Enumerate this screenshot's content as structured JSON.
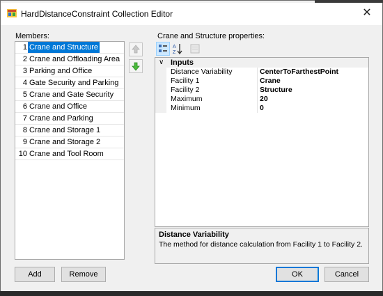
{
  "window": {
    "title": "HardDistanceConstraint Collection Editor",
    "close_glyph": "✕"
  },
  "members": {
    "label": "Members:",
    "selected_index": 0,
    "items": [
      {
        "num": "1",
        "label": "Crane and Structure"
      },
      {
        "num": "2",
        "label": "Crane and Offloading Area"
      },
      {
        "num": "3",
        "label": "Parking and Office"
      },
      {
        "num": "4",
        "label": "Gate Security and Parking"
      },
      {
        "num": "5",
        "label": "Crane and Gate Security"
      },
      {
        "num": "6",
        "label": "Crane and Office"
      },
      {
        "num": "7",
        "label": "Crane and Parking"
      },
      {
        "num": "8",
        "label": "Crane and Storage 1"
      },
      {
        "num": "9",
        "label": "Crane and Storage 2"
      },
      {
        "num": "10",
        "label": "Crane and Tool Room"
      }
    ]
  },
  "properties": {
    "label": "Crane and Structure properties:",
    "toolbar": {
      "categorized_icon": "categorized-icon",
      "alphabetical_icon": "alphabetical-icon",
      "pages_icon": "property-pages-icon"
    },
    "category": {
      "chevron": "∨",
      "name": "Inputs"
    },
    "rows": [
      {
        "name": "Distance Variability",
        "value": "CenterToFarthestPoint"
      },
      {
        "name": "Facility 1",
        "value": "Crane"
      },
      {
        "name": "Facility 2",
        "value": "Structure"
      },
      {
        "name": "Maximum",
        "value": "20"
      },
      {
        "name": "Minimum",
        "value": "0"
      }
    ],
    "description": {
      "title": "Distance Variability",
      "text": "The method for distance calculation from Facility 1 to Facility 2."
    }
  },
  "buttons": {
    "add": "Add",
    "remove": "Remove",
    "ok": "OK",
    "cancel": "Cancel"
  },
  "colors": {
    "selection": "#0078d7",
    "arrow_enabled": "#3aa53a",
    "arrow_disabled": "#b9b9b9"
  }
}
